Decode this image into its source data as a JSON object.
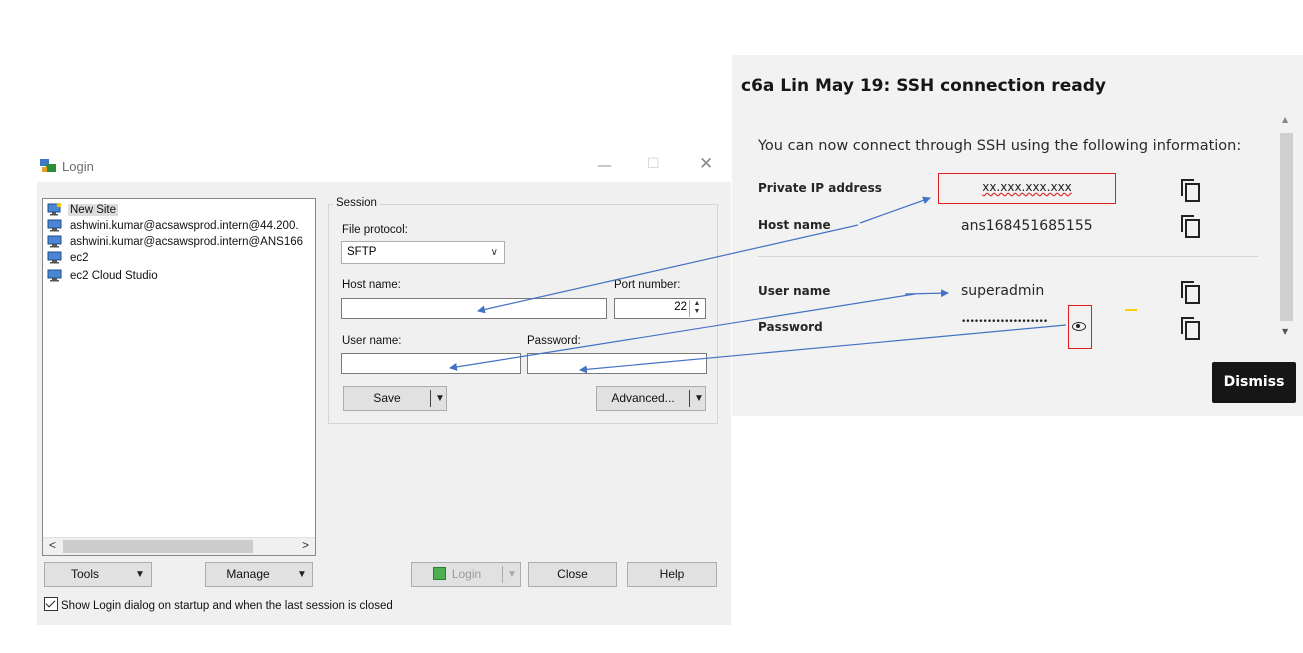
{
  "login_window": {
    "title": "Login",
    "window_controls": {
      "minimize": "—",
      "maximize": "☐",
      "close": "✕"
    },
    "site_tree": [
      "New Site",
      "ashwini.kumar@acsawsprod.intern@44.200.",
      "ashwini.kumar@acsawsprod.intern@ANS166",
      "ec2",
      "ec2 Cloud Studio"
    ],
    "scroll_left": "<",
    "scroll_right": ">",
    "session": {
      "legend": "Session",
      "file_protocol_label": "File protocol:",
      "file_protocol_value": "SFTP",
      "host_name_label": "Host name:",
      "host_name_value": "",
      "port_label": "Port number:",
      "port_value": "22",
      "user_name_label": "User name:",
      "user_name_value": "",
      "password_label": "Password:",
      "password_value": "",
      "save_label": "Save",
      "advanced_label": "Advanced..."
    },
    "buttons": {
      "tools": "Tools",
      "manage": "Manage",
      "login": "Login",
      "close": "Close",
      "help": "Help"
    },
    "show_login_checkbox": {
      "label": "Show Login dialog on startup and when the last session is closed",
      "checked": true
    }
  },
  "ssh_panel": {
    "title": "c6a Lin May 19: SSH connection ready",
    "description": "You can now connect through SSH using the following information:",
    "fields": [
      {
        "label": "Private IP address",
        "value": "xx.xxx.xxx.xxx"
      },
      {
        "label": "Host name",
        "value": "ans168451685155"
      },
      {
        "label": "User name",
        "value": "superadmin"
      },
      {
        "label": "Password",
        "value": "••••••••••••••••••••"
      }
    ],
    "dismiss_label": "Dismiss"
  },
  "colors": {
    "annotation_arrow": "#4472c4",
    "highlight_box": "#e02020",
    "dismiss_bg": "#161616"
  }
}
